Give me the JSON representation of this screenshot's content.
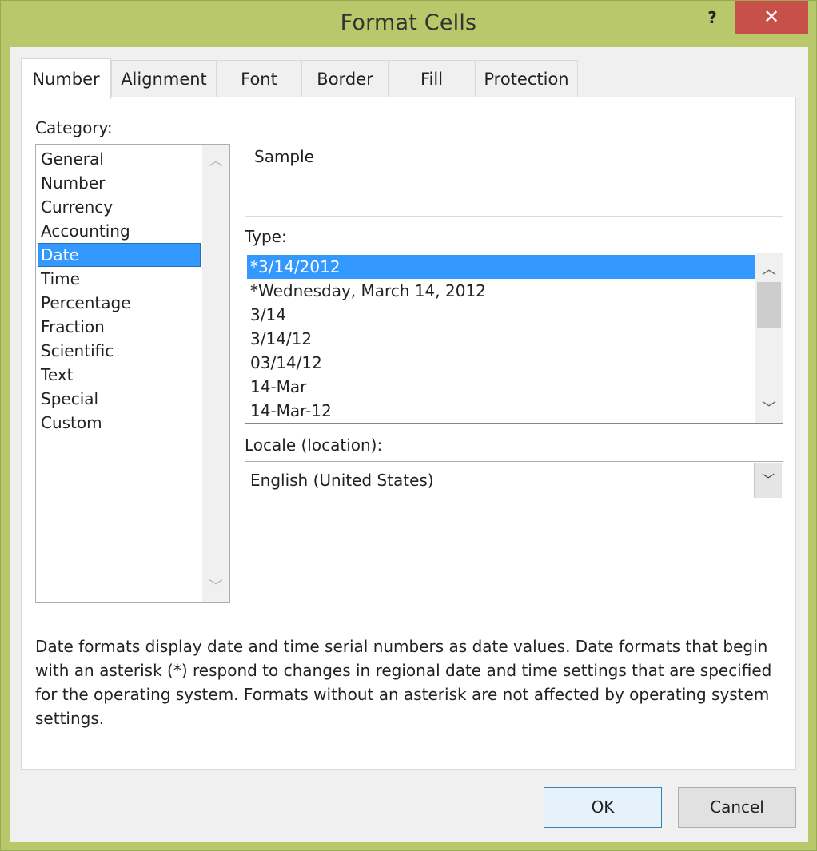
{
  "window": {
    "title": "Format Cells",
    "help_label": "?",
    "close_label": "✕"
  },
  "tabs": [
    {
      "label": "Number",
      "active": true
    },
    {
      "label": "Alignment",
      "active": false
    },
    {
      "label": "Font",
      "active": false
    },
    {
      "label": "Border",
      "active": false
    },
    {
      "label": "Fill",
      "active": false
    },
    {
      "label": "Protection",
      "active": false
    }
  ],
  "category": {
    "label": "Category:",
    "items": [
      "General",
      "Number",
      "Currency",
      "Accounting",
      "Date",
      "Time",
      "Percentage",
      "Fraction",
      "Scientific",
      "Text",
      "Special",
      "Custom"
    ],
    "selected": "Date"
  },
  "sample": {
    "label": "Sample",
    "value": ""
  },
  "type": {
    "label": "Type:",
    "items": [
      "*3/14/2012",
      "*Wednesday, March 14, 2012",
      "3/14",
      "3/14/12",
      "03/14/12",
      "14-Mar",
      "14-Mar-12"
    ],
    "selected": "*3/14/2012"
  },
  "locale": {
    "label": "Locale (location):",
    "value": "English (United States)"
  },
  "description": "Date formats display date and time serial numbers as date values.  Date formats that begin with an asterisk (*) respond to changes in regional date and time settings that are specified for the operating system. Formats without an asterisk are not affected by operating system settings.",
  "buttons": {
    "ok": "OK",
    "cancel": "Cancel"
  },
  "icons": {
    "up": "chevron-up-icon",
    "down": "chevron-down-icon"
  }
}
